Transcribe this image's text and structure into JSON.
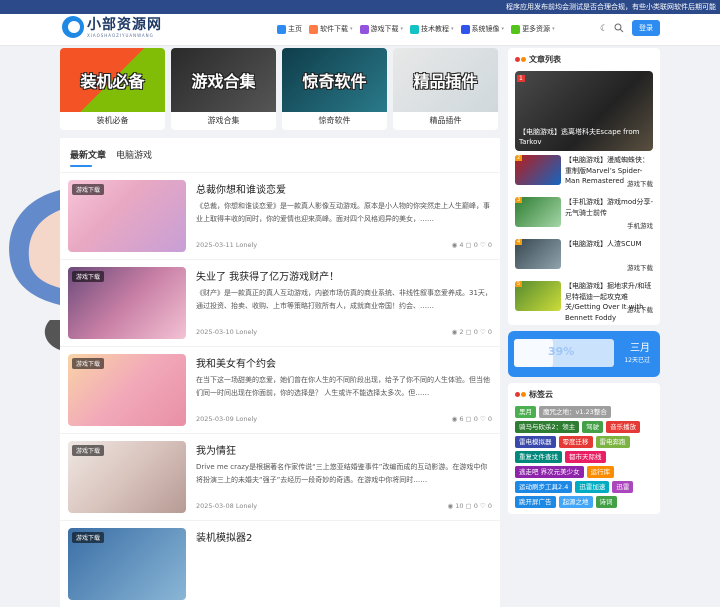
{
  "ticker": "程序应用发布前均会测试是否合理合规，有些小类联网软件后期可能",
  "logo": {
    "cn": "小部资源网",
    "en": "XIAOSHAOZIYUANWANG"
  },
  "nav": [
    {
      "label": "主页",
      "color": "#2e8cf0"
    },
    {
      "label": "软件下载",
      "color": "#ff7a45"
    },
    {
      "label": "游戏下载",
      "color": "#9254de"
    },
    {
      "label": "技术教程",
      "color": "#13c2c2"
    },
    {
      "label": "系统镜像",
      "color": "#2f54eb"
    },
    {
      "label": "更多资源",
      "color": "#52c41a"
    }
  ],
  "login": "登录",
  "categories": [
    {
      "img_text": "装机必备",
      "label": "装机必备",
      "bg": "linear-gradient(135deg,#f35325 0 50%,#81bc06 50%)"
    },
    {
      "img_text": "游戏合集",
      "label": "游戏合集",
      "bg": "linear-gradient(135deg,#2a2a2a,#555)"
    },
    {
      "img_text": "惊奇软件",
      "label": "惊奇软件",
      "bg": "linear-gradient(135deg,#0f3d4a,#2a7a8a)"
    },
    {
      "img_text": "精品插件",
      "label": "精品插件",
      "bg": "linear-gradient(135deg,#e8e8e8,#cfd8dc)"
    }
  ],
  "tabs": [
    "最新文章",
    "电脑游戏"
  ],
  "posts": [
    {
      "badge": "游戏下载",
      "title": "总裁你想和谁谈恋爱",
      "excerpt": "《总裁，你想和谁谈恋爱》是一款真人影像互动游戏。原本是小人物的你突然走上人生巅峰，事业上取得丰收的同时，你的爱情也迎来高峰。面对四个风格迥异的美女，……",
      "meta": "2025-03-11 Lonely",
      "stats": "◉ 4 ▢ 0 ♡ 0",
      "thumb": "linear-gradient(135deg,#f7c6d9,#e9a8c2 40%,#c79fd6)"
    },
    {
      "badge": "游戏下载",
      "title": "失业了 我获得了亿万游戏财产！",
      "excerpt": "《财产》是一款真正的真人互动游戏，内嵌市场仿真的商业系统、非线性叙事恋爱养成。31天，通过投资、抬卖、收购、上市等策略打败所有人，成就商业帝国！约会、……",
      "meta": "2025-03-10 Lonely",
      "stats": "◉ 2 ▢ 0 ♡ 0",
      "thumb": "linear-gradient(135deg,#6b4a7a,#c87fa5 50%,#f3c2d4)"
    },
    {
      "badge": "游戏下载",
      "title": "我和美女有个约会",
      "excerpt": "在当下这一场甜美的恋爱，她们曾在你人生的不同阶段出现，给予了你不同的人生体验。但当他们同一时间出现在你面前，你的选择是？ 人生或许不能选择太多次。但……",
      "meta": "2025-03-09 Lonely",
      "stats": "◉ 6 ▢ 0 ♡ 0",
      "thumb": "linear-gradient(135deg,#f9d3a6,#f2a9b9 50%,#e88fa6)"
    },
    {
      "badge": "游戏下载",
      "title": "我为情狂",
      "excerpt": "Drive me crazy是根据著名作家传说“三上悠亚结婚鉴事件”改编而成的互动影游。在游戏中你将扮演三上的未婚夫“强子”去经历一段奇妙的奇遇。在游戏中你将同时……",
      "meta": "2025-03-08 Lonely",
      "stats": "◉ 10 ▢ 0 ♡ 0",
      "thumb": "linear-gradient(135deg,#efe7e2,#d9c3bd 50%,#b79a94)"
    },
    {
      "badge": "游戏下载",
      "title": "装机模拟器2",
      "excerpt": "",
      "meta": "",
      "stats": "",
      "thumb": "linear-gradient(135deg,#3a6ea5,#8ab6d6)"
    }
  ],
  "sidebar": {
    "title": "文章列表",
    "featured": {
      "num": "1",
      "title": "【电脑游戏】逃离塔科夫Escape from Tarkov"
    },
    "items": [
      {
        "num": "2",
        "title": "【电脑游戏】漫威蜘蛛侠：重制版Marvel’s Spider-Man Remastered",
        "cat": "游戏下载",
        "thumb": "linear-gradient(135deg,#b71c1c,#1565c0)"
      },
      {
        "num": "3",
        "title": "【手机游戏】游戏mod分享-元气骑士前传",
        "cat": "手机游戏",
        "thumb": "linear-gradient(135deg,#2e7d32,#a5d6a7)"
      },
      {
        "num": "4",
        "title": "【电脑游戏】人渣SCUM",
        "cat": "游戏下载",
        "thumb": "linear-gradient(135deg,#37474f,#90a4ae)"
      },
      {
        "num": "5",
        "title": "【电脑游戏】掘地求升/和班尼特福迪一起攻克难关/Getting Over It with Bennett Foddy",
        "cat": "游戏下载",
        "thumb": "linear-gradient(135deg,#558b2f,#cddc39)"
      }
    ],
    "month": {
      "pct": "39%",
      "fill": 0.39,
      "name": "三月",
      "sub": "12天已过"
    },
    "tags_title": "标签云",
    "tags": [
      {
        "t": "黑月",
        "c": "#4caf50"
      },
      {
        "t": "魔咒之地：v1.23整合",
        "c": "#9e9e9e"
      },
      {
        "t": "骑马与砍杀2：领主",
        "c": "#2e7d32"
      },
      {
        "t": "驾驶",
        "c": "#43a047"
      },
      {
        "t": "音乐播放",
        "c": "#e53935"
      },
      {
        "t": "雷电模拟器",
        "c": "#3949ab"
      },
      {
        "t": "零度迁移",
        "c": "#e53935"
      },
      {
        "t": "雷电奔跑",
        "c": "#7cb342"
      },
      {
        "t": "重复文件查找",
        "c": "#00897b"
      },
      {
        "t": "都市天际线",
        "c": "#e91e63"
      },
      {
        "t": "逃走吧 界次元美少女",
        "c": "#8e24aa"
      },
      {
        "t": "运行库",
        "c": "#fb8c00"
      },
      {
        "t": "运动刷步工具2.4",
        "c": "#1e88e5"
      },
      {
        "t": "迅雷加速",
        "c": "#00acc1"
      },
      {
        "t": "迅雷",
        "c": "#ab47bc"
      },
      {
        "t": "跳开屏广告",
        "c": "#1e88e5"
      },
      {
        "t": "起源之地",
        "c": "#42a5f5"
      },
      {
        "t": "诗词",
        "c": "#43a047"
      }
    ]
  }
}
